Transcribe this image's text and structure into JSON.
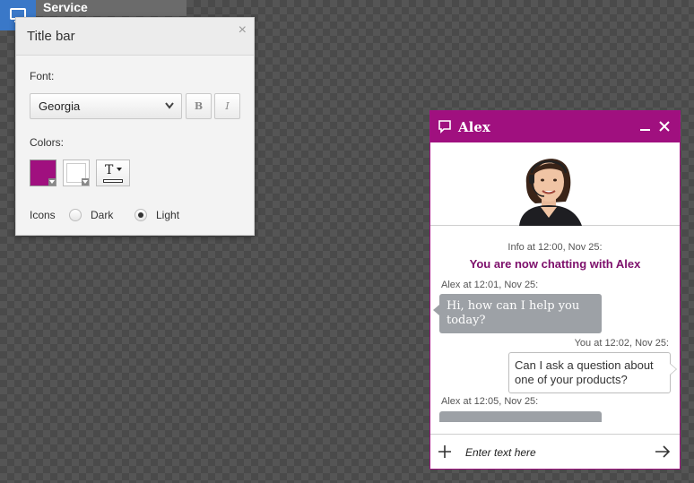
{
  "top_tab": {
    "label": "Service"
  },
  "panel": {
    "title": "Title bar",
    "close_glyph": "×",
    "font_label": "Font:",
    "font_value": "Georgia",
    "bold_label": "B",
    "italic_label": "I",
    "colors_label": "Colors:",
    "text_color_glyph": "T",
    "icons_label": "Icons",
    "icons_options": [
      {
        "label": "Dark",
        "checked": false
      },
      {
        "label": "Light",
        "checked": true
      }
    ],
    "title_color": "#a0107f"
  },
  "chat": {
    "agent_name": "Alex",
    "accent_color": "#a0107f",
    "messages": {
      "info_meta": "Info at 12:00, Nov 25:",
      "status_text": "You are now chatting with Alex",
      "agent_meta_1": "Alex at 12:01, Nov 25:",
      "agent_msg_1": "Hi, how can I help you today?",
      "user_meta_1": "You at 12:02, Nov 25:",
      "user_msg_1": "Can I ask a question about one of your products?",
      "agent_meta_2": "Alex at 12:05, Nov 25:"
    },
    "input_placeholder": "Enter text here"
  }
}
